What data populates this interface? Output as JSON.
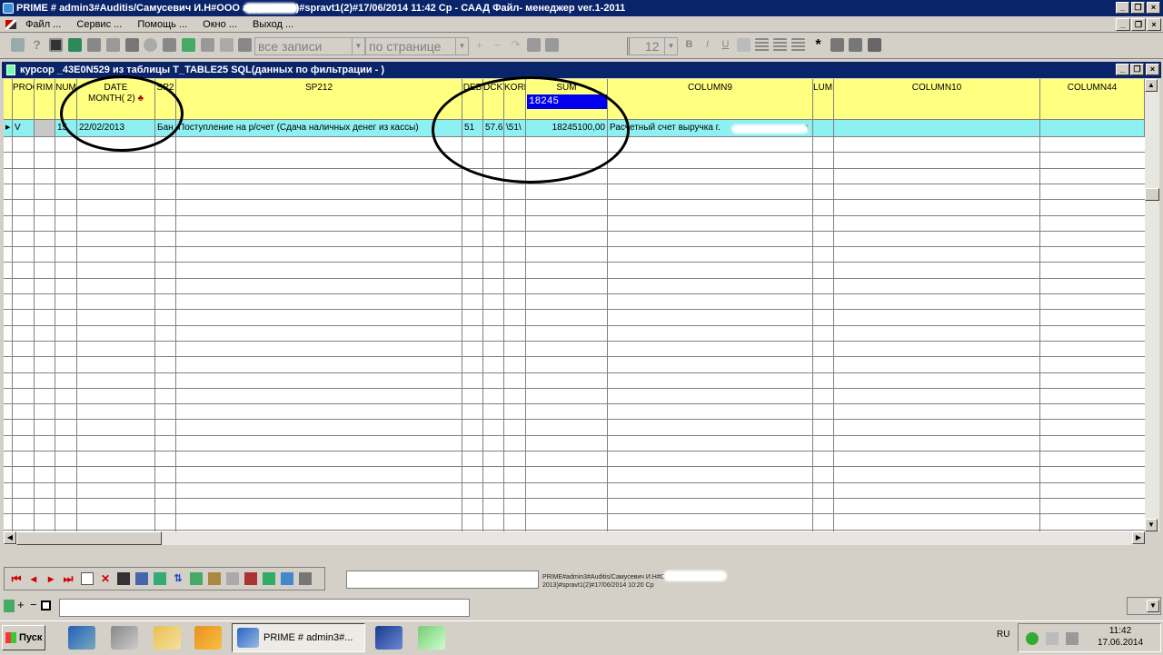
{
  "title": "PRIME # admin3#Auditis/Самусевич И.Н#ООО                  аудит 2013)#spravt1(2)#17/06/2014 11:42 Ср - СААД Файл- менеджер ver.1-2011",
  "menu": [
    "Файл ...",
    "Сервис ...",
    "Помощь ...",
    "Окно ...",
    "Выход ..."
  ],
  "toolbar": {
    "records_combo": "все записи",
    "page_combo": "по странице",
    "font_size": "12",
    "bold": "B",
    "italic": "I",
    "underline": "U",
    "star": "*"
  },
  "child_title": "курсор _43E0N529 из таблицы T_TABLE25 SQL(данных по фильтрации - )",
  "grid": {
    "headers": [
      "PROC",
      "RIM",
      "NUM",
      "DATE",
      "SP2",
      "SP212",
      "DEB",
      "DCKT",
      "KORR",
      "SUM",
      "COLUMN9",
      "LUMN",
      "COLUMN10",
      "COLUMN44"
    ],
    "date_sub": "MONTH( 2)",
    "sum_edit": "18245",
    "row": {
      "proc": "V",
      "rim": "",
      "num": "15",
      "date": "22/02/2013",
      "sp2": "Бан",
      "sp212": "Поступление на р/счет (Сдача наличных денег из кассы)",
      "deb": "51",
      "dckt": "57.6",
      "korr": "\\51\\",
      "sum": "18245100,00",
      "column9": "Расчетный счет выручка г.",
      "column9_tail": "а"
    }
  },
  "status": {
    "nav_info_line1": "PRIME#admin3#Auditis/Самусевич И.Н#О",
    "nav_info_line2": "2013)#spravt1(2)#17/06/2014 10:20 Ср",
    "plus": "+",
    "minus": "−"
  },
  "taskbar": {
    "start": "Пуск",
    "active_task": "PRIME # admin3#...",
    "lang": "RU",
    "time": "11:42",
    "date": "17.06.2014"
  }
}
